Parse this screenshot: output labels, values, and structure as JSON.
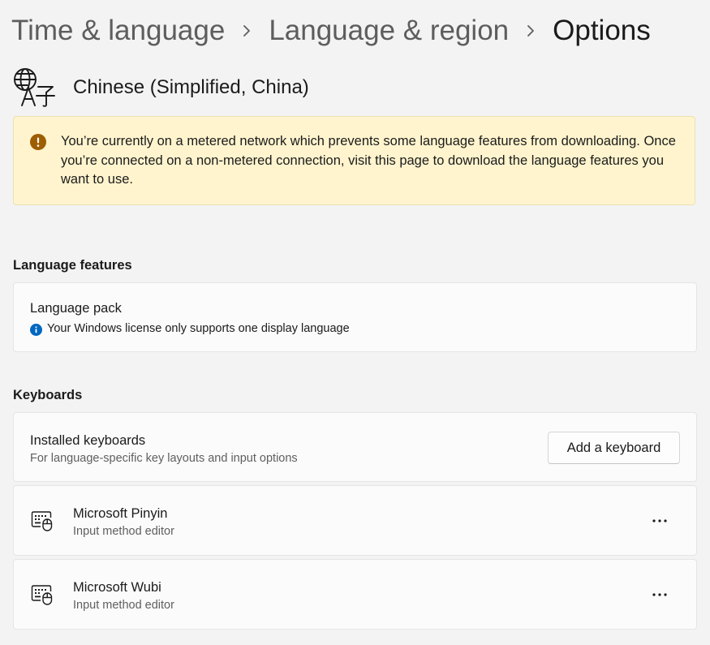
{
  "breadcrumb": {
    "items": [
      "Time & language",
      "Language & region",
      "Options"
    ]
  },
  "language": {
    "name": "Chinese (Simplified, China)",
    "icon": "language-icon"
  },
  "warning": {
    "icon": "warning-icon",
    "text": "You’re currently on a metered network which prevents some language features from downloading. Once you’re connected on a non-metered connection, visit this page to download the language features you want to use."
  },
  "language_features": {
    "title": "Language features",
    "language_pack": {
      "label": "Language pack",
      "info": "Your Windows license only supports one display language",
      "icon": "info-icon"
    }
  },
  "keyboards": {
    "title": "Keyboards",
    "installed": {
      "label": "Installed keyboards",
      "description": "For language-specific key layouts and input options",
      "add_button": "Add a keyboard"
    },
    "items": [
      {
        "name": "Microsoft Pinyin",
        "type": "Input method editor",
        "icon": "keyboard-icon"
      },
      {
        "name": "Microsoft Wubi",
        "type": "Input method editor",
        "icon": "keyboard-icon"
      }
    ]
  },
  "colors": {
    "background": "#f3f3f3",
    "card": "#fbfbfb",
    "warning_background": "#fff4ce",
    "warning_icon": "#9d5d00",
    "info_icon": "#0067c0"
  }
}
